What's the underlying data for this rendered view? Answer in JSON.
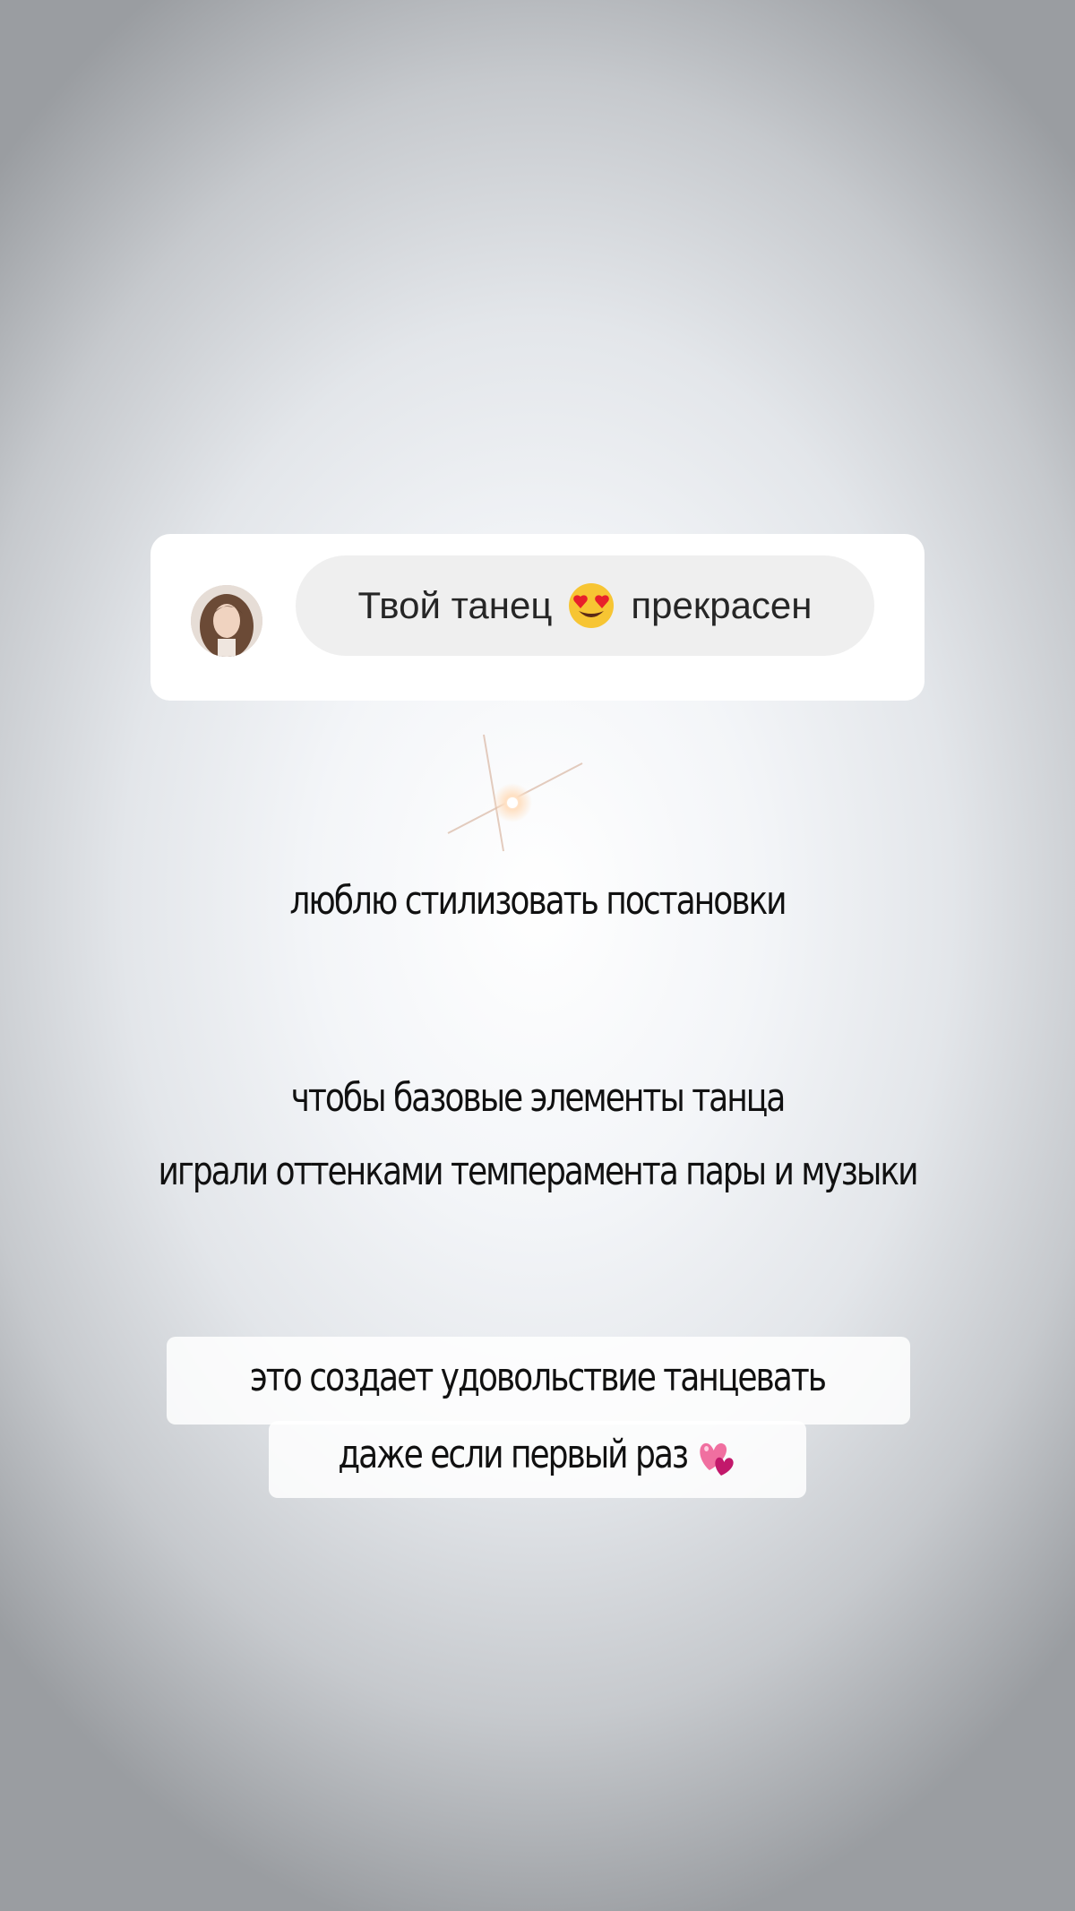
{
  "reply": {
    "text_before": "Твой танец",
    "text_after": "прекрасен",
    "emoji": "heart-eyes-emoji-icon"
  },
  "caption": {
    "line1": "люблю стилизовать постановки",
    "line2": "чтобы базовые элементы танца",
    "line3": "играли оттенками темперамента пары и музыки"
  },
  "highlight": {
    "line1": "это создает удовольствие танцевать",
    "line2": "даже если первый раз",
    "emoji": "two-hearts-icon"
  },
  "decor": {
    "sparkle": "sparkle-icon"
  }
}
